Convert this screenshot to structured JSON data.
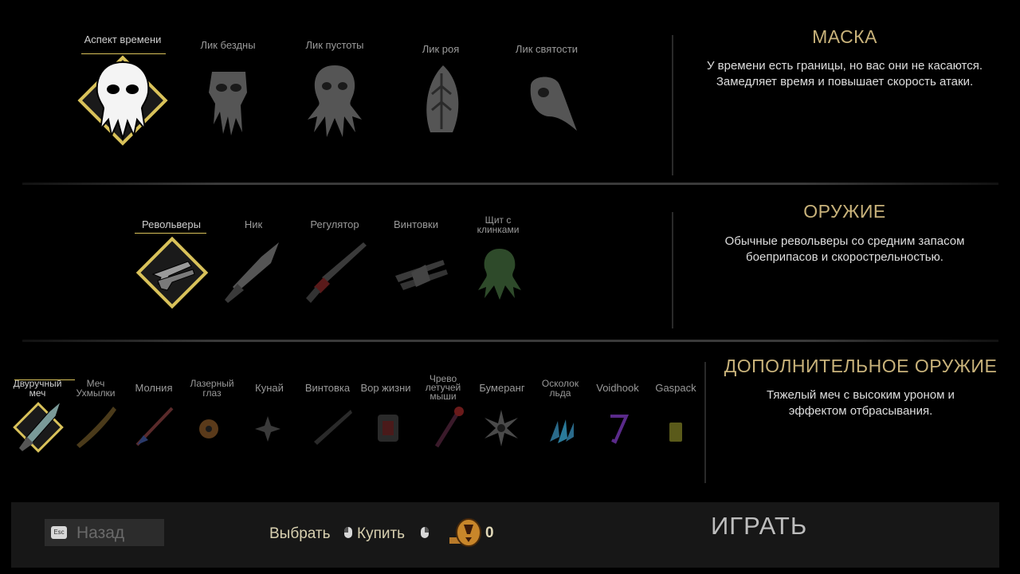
{
  "mask": {
    "title": "МАСКА",
    "description_1": "У времени есть границы, но вас они не касаются.",
    "description_2": "Замедляет время и повышает скорость атаки.",
    "items": [
      {
        "label": "Аспект времени",
        "selected": true
      },
      {
        "label": "Лик бездны",
        "selected": false
      },
      {
        "label": "Лик пустоты",
        "selected": false
      },
      {
        "label": "Лик роя",
        "selected": false
      },
      {
        "label": "Лик святости",
        "selected": false
      }
    ]
  },
  "weapon": {
    "title": "ОРУЖИЕ",
    "description_1": "Обычные револьверы со средним запасом",
    "description_2": "боеприпасов и скорострельностью.",
    "items": [
      {
        "label": "Револьверы",
        "selected": true
      },
      {
        "label": "Ник",
        "selected": false
      },
      {
        "label": "Регулятор",
        "selected": false
      },
      {
        "label": "Винтовки",
        "selected": false
      },
      {
        "label_1": "Щит с",
        "label_2": "клинками",
        "selected": false
      }
    ]
  },
  "secondary": {
    "title": "ДОПОЛНИТЕЛЬНОЕ ОРУЖИЕ",
    "description_1": "Тяжелый меч с высоким уроном и",
    "description_2": "эффектом отбрасывания.",
    "items": [
      {
        "label_1": "Двуручный",
        "label_2": "меч",
        "selected": true
      },
      {
        "label_1": "Меч",
        "label_2": "Ухмылки"
      },
      {
        "label": "Молния"
      },
      {
        "label_1": "Лазерный",
        "label_2": "глаз"
      },
      {
        "label": "Кунай"
      },
      {
        "label": "Винтовка"
      },
      {
        "label": "Вор жизни"
      },
      {
        "label_1": "Чрево",
        "label_2": "летучей",
        "label_3": "мыши"
      },
      {
        "label": "Бумеранг"
      },
      {
        "label_1": "Осколок",
        "label_2": "льда"
      },
      {
        "label": "Voidhook"
      },
      {
        "label": "Gaspack"
      }
    ]
  },
  "footer": {
    "esc_key": "Esc",
    "back_label": "Назад",
    "select_label": "Выбрать",
    "buy_label": "Купить",
    "currency_value": "0",
    "play_label": "ИГРАТЬ"
  },
  "colors": {
    "accent_gold": "#d9c25a",
    "title_gold": "#c8b27a",
    "icon_gray": "#5a5a5a"
  }
}
